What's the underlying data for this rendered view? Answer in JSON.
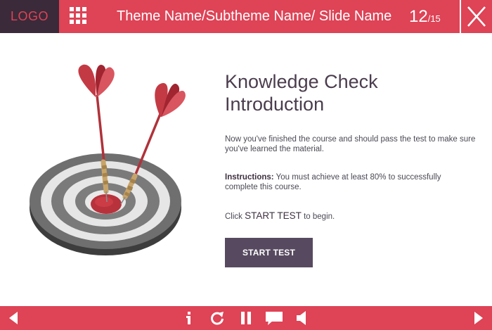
{
  "header": {
    "logo": "LOGO",
    "title": "Theme Name/Subtheme Name/ Slide Name",
    "slide_current": "12",
    "slide_total": "/15"
  },
  "content": {
    "heading_line1": "Knowledge Check",
    "heading_line2": "Introduction",
    "paragraph1": "Now you've finished the course and should pass the test to make sure you've learned the material.",
    "instructions_label": "Instructions:",
    "instructions_text": " You must achieve at least 80% to successfully complete this course.",
    "click_prefix": "Click ",
    "click_strong": "START TEST",
    "click_suffix": " to begin.",
    "start_button": "START TEST"
  },
  "icons": {
    "menu": "grid-icon",
    "close": "close-icon",
    "prev": "triangle-left-icon",
    "info": "info-icon",
    "replay": "replay-icon",
    "pause": "pause-icon",
    "notes": "speech-bubble-icon",
    "volume": "speaker-icon",
    "next": "triangle-right-icon"
  },
  "colors": {
    "accent": "#de4356",
    "logo_bg": "#3a2a3a",
    "heading": "#4b3d4e",
    "button_bg": "#574a60"
  }
}
